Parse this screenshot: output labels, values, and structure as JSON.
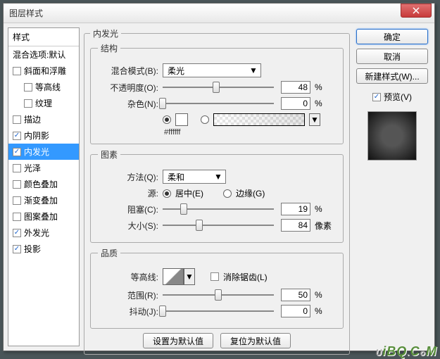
{
  "window": {
    "title": "图层样式"
  },
  "sidebar": {
    "header": "样式",
    "items": [
      {
        "label": "混合选项:默认",
        "checked": null
      },
      {
        "label": "斜面和浮雕",
        "checked": false
      },
      {
        "label": "等高线",
        "checked": false,
        "indent": true
      },
      {
        "label": "纹理",
        "checked": false,
        "indent": true
      },
      {
        "label": "描边",
        "checked": false
      },
      {
        "label": "内阴影",
        "checked": true
      },
      {
        "label": "内发光",
        "checked": true,
        "selected": true
      },
      {
        "label": "光泽",
        "checked": false
      },
      {
        "label": "颜色叠加",
        "checked": false
      },
      {
        "label": "渐变叠加",
        "checked": false
      },
      {
        "label": "图案叠加",
        "checked": false
      },
      {
        "label": "外发光",
        "checked": true
      },
      {
        "label": "投影",
        "checked": true
      }
    ]
  },
  "main": {
    "title": "内发光",
    "structure": {
      "legend": "结构",
      "blend_label": "混合模式(B):",
      "blend_value": "柔光",
      "opacity_label": "不透明度(O):",
      "opacity_value": "48",
      "opacity_unit": "%",
      "noise_label": "杂色(N):",
      "noise_value": "0",
      "noise_unit": "%",
      "hex": "#ffffff"
    },
    "elements": {
      "legend": "图素",
      "technique_label": "方法(Q):",
      "technique_value": "柔和",
      "source_label": "源:",
      "source_center": "居中(E)",
      "source_edge": "边缘(G)",
      "choke_label": "阻塞(C):",
      "choke_value": "19",
      "choke_unit": "%",
      "size_label": "大小(S):",
      "size_value": "84",
      "size_unit": "像素"
    },
    "quality": {
      "legend": "品质",
      "contour_label": "等高线:",
      "antialias": "消除锯齿(L)",
      "range_label": "范围(R):",
      "range_value": "50",
      "range_unit": "%",
      "jitter_label": "抖动(J):",
      "jitter_value": "0",
      "jitter_unit": "%"
    },
    "buttons": {
      "make_default": "设置为默认值",
      "reset_default": "复位为默认值"
    }
  },
  "right": {
    "ok": "确定",
    "cancel": "取消",
    "new_style": "新建样式(W)...",
    "preview": "预览(V)"
  },
  "watermark": "UiBQ.CoM"
}
